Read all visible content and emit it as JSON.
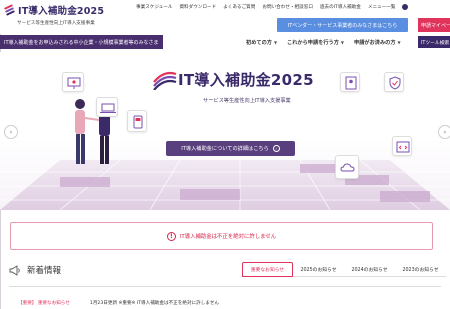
{
  "header": {
    "logo_title": "IT導入補助金2025",
    "logo_sub": "サービス等生産性向上IT導入支援事業",
    "top_nav": [
      "事業スケジュール",
      "資料ダウンロード",
      "よくあるご質問",
      "お問い合わせ・相談窓口",
      "過去のIT導入補助金",
      "メニュー一覧"
    ],
    "vendor_button": "ITベンダー・サービス事業者のみなさまはこちら",
    "mypage_button": "申請マイページ"
  },
  "subnav": {
    "banner": "IT導入補助金をお申込みされる中小企業・小規模事業者等のみなさま",
    "menu": [
      "初めての方",
      "これから申請を行う方",
      "申請がお済みの方"
    ],
    "tool_button": "ITツール検索"
  },
  "hero": {
    "title": "IT導入補助金2025",
    "subtitle": "サービス等生産性向上IT導入支援事業",
    "detail_button": "IT導入補助金についての詳細はこちら"
  },
  "warning": {
    "text": "IT導入補助金は不正を絶対に許しません"
  },
  "news": {
    "title": "新着情報",
    "tabs": [
      "重要なお知らせ",
      "2025のお知らせ",
      "2024のお知らせ",
      "2023のお知らせ"
    ],
    "active_tab": 0,
    "first_item_tag": "【重要】 重要なお知らせ",
    "first_item_text": "1月23日更新 ※重要※ IT導入補助金は不正を絶対に許しません"
  },
  "colors": {
    "brand_purple": "#3a2a6a",
    "accent_pink": "#e0345c",
    "vendor_blue": "#5a8ee0",
    "warning_red": "#d6244a"
  }
}
